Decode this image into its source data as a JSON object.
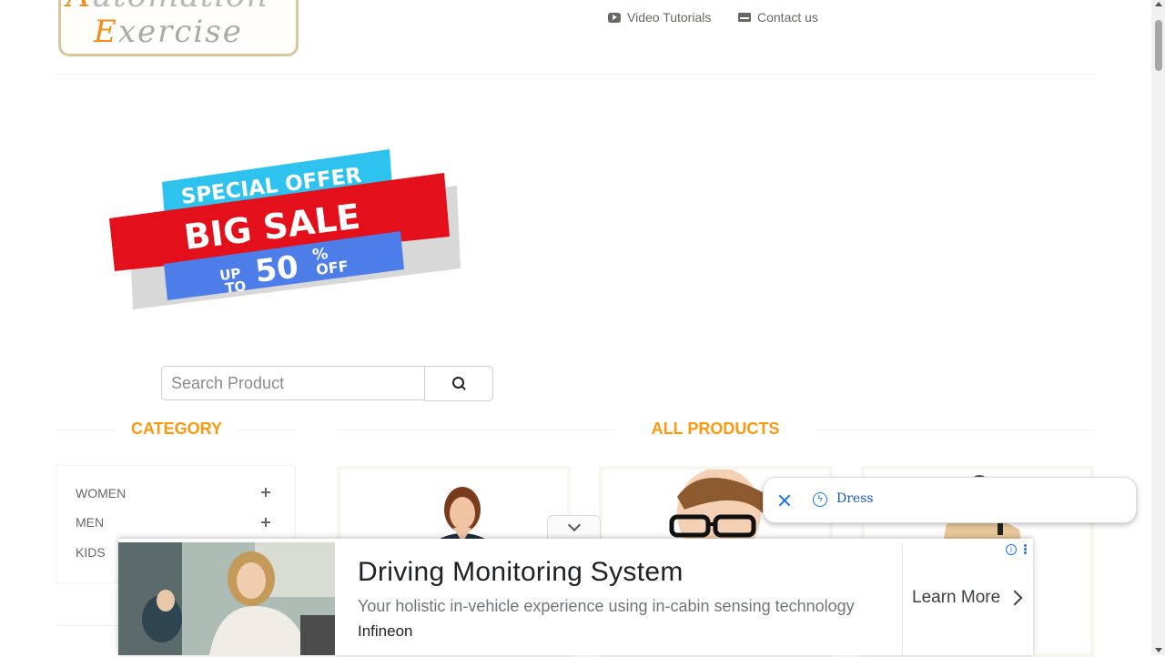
{
  "logo": {
    "line1_first": "A",
    "line1_rest": "utomation",
    "line2_first": "E",
    "line2_rest": "xercise"
  },
  "nav": {
    "video_tutorials": "Video Tutorials",
    "contact_us": "Contact us"
  },
  "sale_banner": {
    "special_offer": "SPECIAL OFFER",
    "big_sale": "BIG SALE",
    "up": "UP",
    "to": "TO",
    "percent_value": "50",
    "percent_sign": "%",
    "off": "OFF"
  },
  "search": {
    "placeholder": "Search Product",
    "icon": "search-icon"
  },
  "category": {
    "title": "CATEGORY",
    "items": [
      {
        "label": "WOMEN",
        "icon": "plus-icon"
      },
      {
        "label": "MEN",
        "icon": "plus-icon"
      },
      {
        "label": "KIDS",
        "icon": "plus-icon"
      }
    ]
  },
  "products": {
    "title": "ALL PRODUCTS"
  },
  "dress_popup": {
    "close_icon": "close-icon",
    "icon": "bolt-icon",
    "text": "Dress"
  },
  "ad": {
    "title": "Driving Monitoring System",
    "description": "Your holistic in-vehicle experience using in-cabin sensing technology",
    "brand": "Infineon",
    "cta": "Learn More",
    "info_glyph": "i"
  },
  "colors": {
    "accent": "#fe980f",
    "link_blue": "#1a73e8",
    "text": "#696763"
  }
}
